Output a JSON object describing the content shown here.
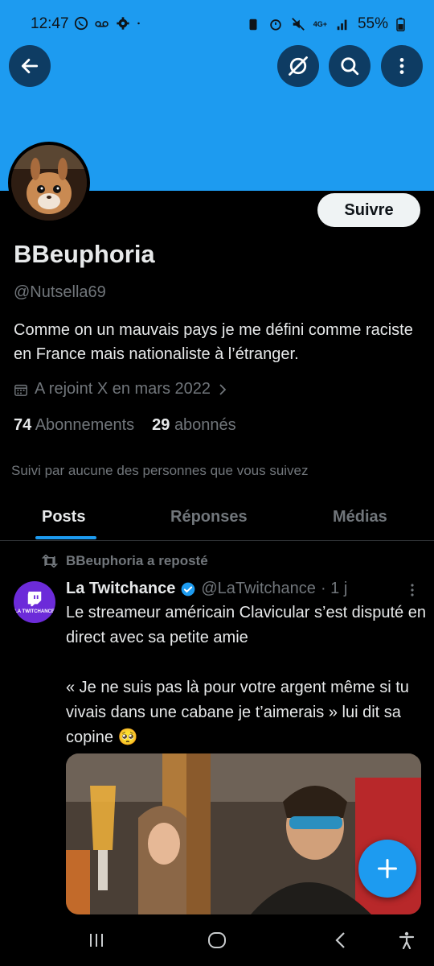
{
  "status_bar": {
    "time": "12:47",
    "battery": "55%",
    "network": "4G+"
  },
  "header": {
    "back_icon": "arrow-left-icon",
    "grok_icon": "grok-icon",
    "search_icon": "search-icon",
    "more_icon": "more-vertical-icon",
    "banner_color": "#1d9bf0"
  },
  "profile": {
    "name": "BBeuphoria",
    "handle": "@Nutsella69",
    "bio": "Comme on un mauvais pays je me défini comme raciste en France mais nationaliste à l’étranger.",
    "joined": "A rejoint X en mars 2022",
    "following_count": "74",
    "following_label": "Abonnements",
    "followers_count": "29",
    "followers_label": "abonnés",
    "followed_by": "Suivi par aucune des personnes que vous suivez",
    "follow_label": "Suivre"
  },
  "tabs": [
    {
      "label": "Posts",
      "active": true
    },
    {
      "label": "Réponses",
      "active": false
    },
    {
      "label": "Médias",
      "active": false
    }
  ],
  "tweet": {
    "repost_label": "BBeuphoria a reposté",
    "author_name": "La Twitchance",
    "author_handle": "@LaTwitchance",
    "time": "· 1 j",
    "avatar_text": "LA TWITCHANCE",
    "text": "Le streameur américain Clavicular s’est disputé en direct avec sa petite amie\n\n« Je ne suis pas là pour votre argent même si tu vivais dans une cabane je t’aimerais » lui dit sa copine 🥺"
  },
  "colors": {
    "accent": "#1d9bf0",
    "text_primary": "#e7e9ea",
    "text_secondary": "#71767b",
    "background": "#000000"
  }
}
